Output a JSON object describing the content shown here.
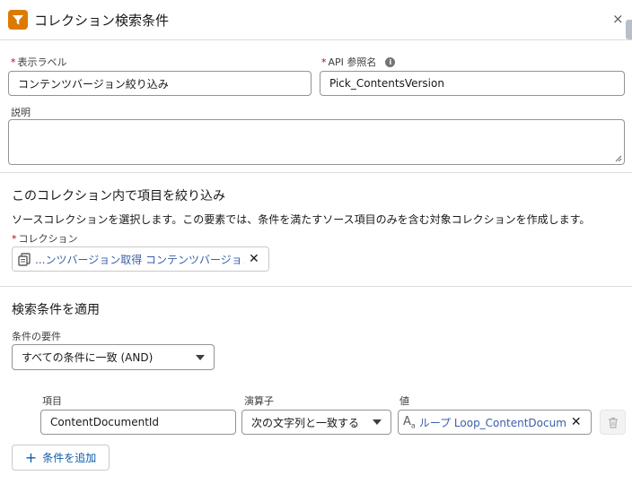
{
  "header": {
    "title": "コレクション検索条件",
    "close_glyph": "×"
  },
  "fields": {
    "label": {
      "label": "表示ラベル",
      "value": "コンテンツバージョン絞り込み"
    },
    "api": {
      "label": "API 参照名",
      "value": "Pick_ContentsVersion",
      "info_glyph": "i"
    },
    "description": {
      "label": "説明",
      "value": ""
    }
  },
  "filter_section": {
    "title": "このコレクション内で項目を絞り込み",
    "description": "ソースコレクションを選択します。この要素では、条件を満たすソース項目のみを含む対象コレクションを作成します。",
    "collection_label": "コレクション",
    "collection_value": "...ンツバージョン取得 コンテンツバージョン"
  },
  "conditions_section": {
    "title": "検索条件を適用",
    "requirement_label": "条件の要件",
    "requirement_value": "すべての条件に一致 (AND)",
    "row": {
      "field_label": "項目",
      "field_value": "ContentDocumentId",
      "operator_label": "演算子",
      "operator_value": "次の文字列と一致する",
      "value_label": "値",
      "value_value": "ループ Loop_ContentDocume..."
    },
    "add_condition_label": "条件を追加",
    "required_mark": "*"
  }
}
